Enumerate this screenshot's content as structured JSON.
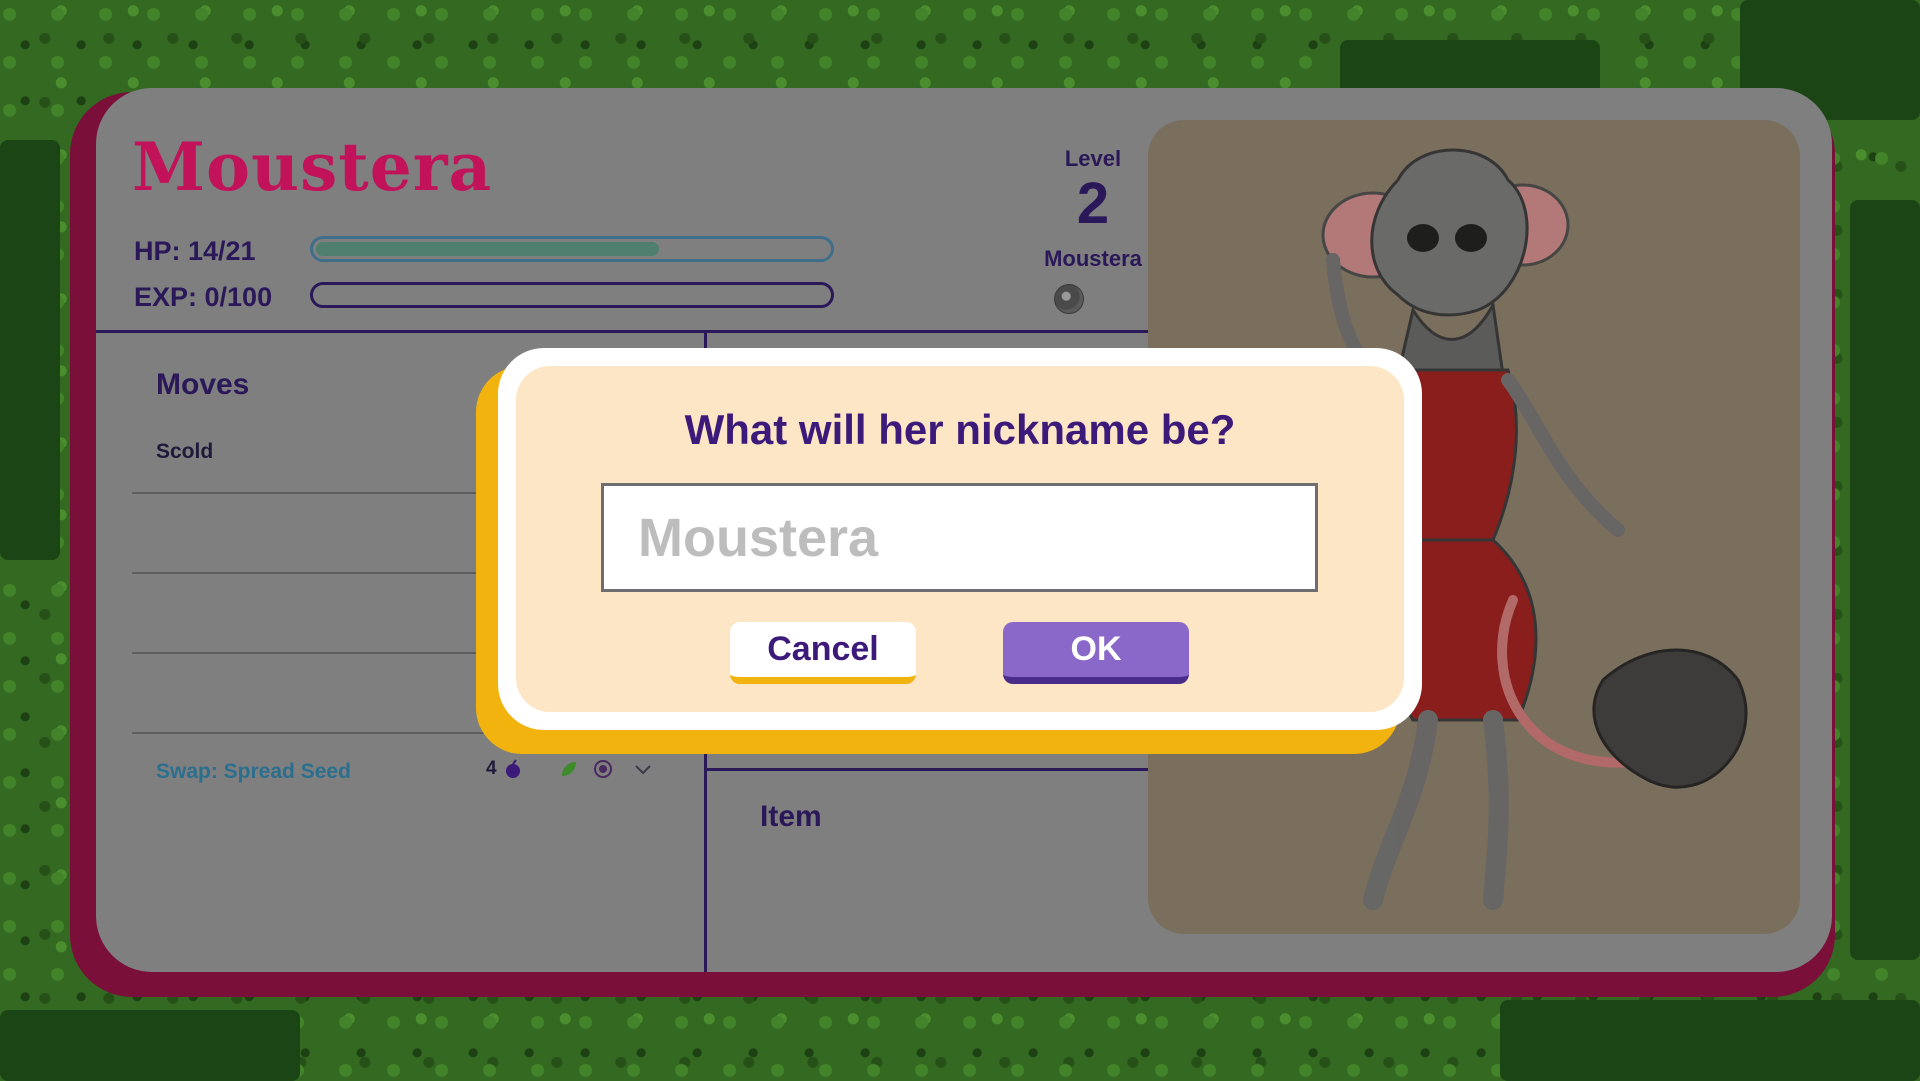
{
  "creature": {
    "name": "Moustera",
    "hp_label": "HP: 14/21",
    "hp_fraction": 0.67,
    "exp_label": "EXP: 0/100",
    "exp_fraction": 0.0,
    "level_label": "Level",
    "level_value": "2",
    "species": "Moustera",
    "type_icon": "dark-orb-icon"
  },
  "moves": {
    "title": "Moves",
    "list": [
      "Scold",
      "",
      "",
      ""
    ],
    "swap": {
      "label": "Swap: Spread Seed",
      "cost": "4",
      "cost_icon": "seed-bag-icon",
      "type_icon": "leaf-icon",
      "target_icon": "target-icon",
      "expand_icon": "chevron-down-icon"
    }
  },
  "item": {
    "title": "Item"
  },
  "modal": {
    "title": "What will her nickname be?",
    "input_value": "",
    "input_placeholder": "Moustera",
    "cancel_label": "Cancel",
    "ok_label": "OK"
  },
  "colors": {
    "title": "#c21259",
    "accent": "#3c1a7a",
    "modal_bg": "#fde6c6",
    "modal_border": "#f2b30f",
    "ok_button": "#8a68c9"
  }
}
